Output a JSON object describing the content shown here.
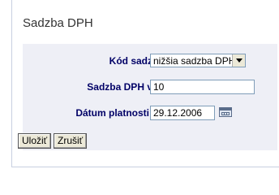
{
  "page": {
    "title": "Sadzba DPH"
  },
  "form": {
    "kod_sadzby": {
      "label": "Kód sadzby:",
      "value": "nižšia sadzba DPH"
    },
    "sadzba": {
      "label": "Sadzba DPH v %:",
      "value": "10"
    },
    "datum": {
      "label": "Dátum platnosti od:",
      "value": "29.12.2006"
    }
  },
  "buttons": {
    "save_label": "Uložiť",
    "cancel_label": "Zrušiť"
  },
  "icons": {
    "calendar": "calendar-icon",
    "dropdown": "chevron-down-icon"
  }
}
